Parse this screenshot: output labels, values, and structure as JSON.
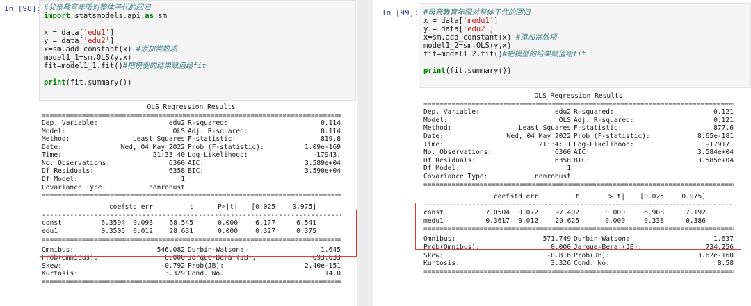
{
  "cells": [
    {
      "prompt": "In [98]:",
      "code": [
        {
          "type": "comment",
          "text": "#父亲教育年限对整体子代的回归"
        },
        {
          "type": "import",
          "kw1": "import",
          "mod": " statsmodels.api ",
          "kw2": "as",
          "alias": " sm"
        },
        {
          "type": "blank",
          "text": ""
        },
        {
          "type": "assign",
          "pre": "x = data[",
          "str": "'edu1'",
          "post": "]"
        },
        {
          "type": "assign",
          "pre": "y = data[",
          "str": "'edu2'",
          "post": "]"
        },
        {
          "type": "codecmt",
          "code": "x=sm.add_constant(x) ",
          "cmt": "#添加常数项"
        },
        {
          "type": "plain",
          "text": "model1_1=sm.OLS(y,x)"
        },
        {
          "type": "codecmt",
          "code": "fit=model1_1.fit()",
          "cmt": "#把模型的结果赋值给fit"
        },
        {
          "type": "blank",
          "text": ""
        },
        {
          "type": "print",
          "kw": "print",
          "rest": "(fit.summary())"
        }
      ],
      "summary": {
        "title": "OLS Regression Results",
        "sep_double": "==============================================================================",
        "sep_single": "------------------------------------------------------------------------------",
        "info": [
          [
            "Dep. Variable:",
            "edu2",
            "R-squared:",
            "0.114"
          ],
          [
            "Model:",
            "OLS",
            "Adj. R-squared:",
            "0.114"
          ],
          [
            "Method:",
            "Least Squares",
            "F-statistic:",
            "819.8"
          ],
          [
            "Date:",
            "Wed, 04 May 2022",
            "Prob (F-statistic):",
            "1.09e-169"
          ],
          [
            "Time:",
            "21:33:40",
            "Log-Likelihood:",
            "-17943."
          ],
          [
            "No. Observations:",
            "6360",
            "AIC:",
            "3.589e+04"
          ],
          [
            "Df Residuals:",
            "6358",
            "BIC:",
            "3.590e+04"
          ],
          [
            "Df Model:",
            "1",
            "",
            ""
          ],
          [
            "Covariance Type:",
            "nonrobust",
            "",
            ""
          ]
        ],
        "coef_header": [
          "coef",
          "std err",
          "t",
          "P>|t|",
          "[0.025",
          "0.975]"
        ],
        "coef_rows": [
          [
            "const",
            "6.3594",
            "0.093",
            "68.545",
            "0.000",
            "6.177",
            "6.541"
          ],
          [
            "edu1",
            "0.3505",
            "0.012",
            "28.631",
            "0.000",
            "0.327",
            "0.375"
          ]
        ],
        "diag": [
          [
            "Omnibus:",
            "546.082",
            "Durbin-Watson:",
            "1.645"
          ],
          [
            "Prob(Omnibus):",
            "0.000",
            "Jarque-Bera (JB):",
            "693.633"
          ],
          [
            "Skew:",
            "-0.792",
            "Prob(JB):",
            "2.40e-151"
          ],
          [
            "Kurtosis:",
            "3.329",
            "Cond. No.",
            "14.0"
          ]
        ]
      }
    },
    {
      "prompt": "In [99]:",
      "code": [
        {
          "type": "comment",
          "text": "#母亲教育年限对整体子代的回归"
        },
        {
          "type": "assign",
          "pre": "x = data[",
          "str": "'medu1'",
          "post": "]"
        },
        {
          "type": "assign",
          "pre": "y = data[",
          "str": "'edu2'",
          "post": "]"
        },
        {
          "type": "codecmt",
          "code": "x=sm.add_constant(x) ",
          "cmt": "#添加常数项"
        },
        {
          "type": "plain",
          "text": "model1_2=sm.OLS(y,x)"
        },
        {
          "type": "codecmt",
          "code": "fit=model1_2.fit()",
          "cmt": "#把模型的结果赋值给fit"
        },
        {
          "type": "blank",
          "text": ""
        },
        {
          "type": "print",
          "kw": "print",
          "rest": "(fit.summary())"
        }
      ],
      "summary": {
        "title": "OLS Regression Results",
        "sep_double": "==============================================================================",
        "sep_single": "------------------------------------------------------------------------------",
        "info": [
          [
            "Dep. Variable:",
            "edu2",
            "R-squared:",
            "0.121"
          ],
          [
            "Model:",
            "OLS",
            "Adj. R-squared:",
            "0.121"
          ],
          [
            "Method:",
            "Least Squares",
            "F-statistic:",
            "877.6"
          ],
          [
            "Date:",
            "Wed, 04 May 2022",
            "Prob (F-statistic):",
            "8.65e-181"
          ],
          [
            "Time:",
            "21:34:11",
            "Log-Likelihood:",
            "-17917."
          ],
          [
            "No. Observations:",
            "6360",
            "AIC:",
            "3.584e+04"
          ],
          [
            "Df Residuals:",
            "6358",
            "BIC:",
            "3.585e+04"
          ],
          [
            "Df Model:",
            "1",
            "",
            ""
          ],
          [
            "Covariance Type:",
            "nonrobust",
            "",
            ""
          ]
        ],
        "coef_header": [
          "coef",
          "std err",
          "t",
          "P>|t|",
          "[0.025",
          "0.975]"
        ],
        "coef_rows": [
          [
            "const",
            "7.0504",
            "0.072",
            "97.402",
            "0.000",
            "6.908",
            "7.192"
          ],
          [
            "medu1",
            "0.3617",
            "0.012",
            "29.625",
            "0.000",
            "0.338",
            "0.386"
          ]
        ],
        "diag": [
          [
            "Omnibus:",
            "571.749",
            "Durbin-Watson:",
            "1.637"
          ],
          [
            "Prob(Omnibus):",
            "0.000",
            "Jarque-Bera (JB):",
            "734.256"
          ],
          [
            "Skew:",
            "-0.816",
            "Prob(JB):",
            "3.62e-160"
          ],
          [
            "Kurtosis:",
            "3.326",
            "Cond. No.",
            "8.58"
          ]
        ]
      }
    }
  ]
}
